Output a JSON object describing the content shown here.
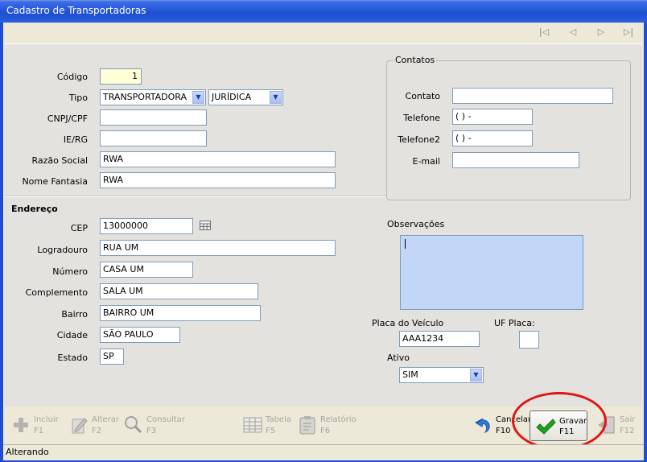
{
  "window": {
    "title": "Cadastro de Transportadoras"
  },
  "nav": {
    "first_icon": "first-record-icon",
    "prev_icon": "previous-record-icon",
    "next_icon": "next-record-icon",
    "last_icon": "last-record-icon"
  },
  "form": {
    "codigo": {
      "label": "Código",
      "value": "1"
    },
    "tipo": {
      "label": "Tipo",
      "value1": "TRANSPORTADORA",
      "value2": "JURÍDICA"
    },
    "cnpj": {
      "label": "CNPJ/CPF",
      "value": ""
    },
    "ie": {
      "label": "IE/RG",
      "value": ""
    },
    "razao": {
      "label": "Razão Social",
      "value": "RWA"
    },
    "fantasia": {
      "label": "Nome Fantasia",
      "value": "RWA"
    }
  },
  "contatos": {
    "legend": "Contatos",
    "contato": {
      "label": "Contato",
      "value": ""
    },
    "telefone": {
      "label": "Telefone",
      "value": "( )    -"
    },
    "telefone2": {
      "label": "Telefone2",
      "value": "( )    -"
    },
    "email": {
      "label": "E-mail",
      "value": ""
    }
  },
  "endereco": {
    "title": "Endereço",
    "cep": {
      "label": "CEP",
      "value": "13000000"
    },
    "logradouro": {
      "label": "Logradouro",
      "value": "RUA UM"
    },
    "numero": {
      "label": "Número",
      "value": "CASA UM"
    },
    "complemento": {
      "label": "Complemento",
      "value": "SALA UM"
    },
    "bairro": {
      "label": "Bairro",
      "value": "BAIRRO UM"
    },
    "cidade": {
      "label": "Cidade",
      "value": "SÃO PAULO"
    },
    "estado": {
      "label": "Estado",
      "value": "SP"
    }
  },
  "extra": {
    "observacoes_label": "Observações",
    "placa_label": "Placa do Veículo",
    "placa_value": "AAA1234",
    "uf_placa_label": "UF Placa:",
    "uf_placa_value": "",
    "ativo_label": "Ativo",
    "ativo_value": "SIM"
  },
  "toolbar": {
    "incluir": [
      "Incluir",
      "F1"
    ],
    "alterar": [
      "Alterar",
      "F2"
    ],
    "consultar": [
      "Consultar",
      "F3"
    ],
    "tabela": [
      "Tabela",
      "F5"
    ],
    "relatorio": [
      "Relatório",
      "F6"
    ],
    "cancelar": [
      "Cancelar",
      "F10"
    ],
    "gravar": [
      "Gravar",
      "F11"
    ],
    "sair": [
      "Sair",
      "F12"
    ]
  },
  "status": {
    "text": "Alterando"
  },
  "colors": {
    "title_bar": "#2657d8",
    "textarea": "#c2d6f7",
    "highlight_ellipse": "#e01515",
    "gravar_check": "#1ea11e"
  }
}
